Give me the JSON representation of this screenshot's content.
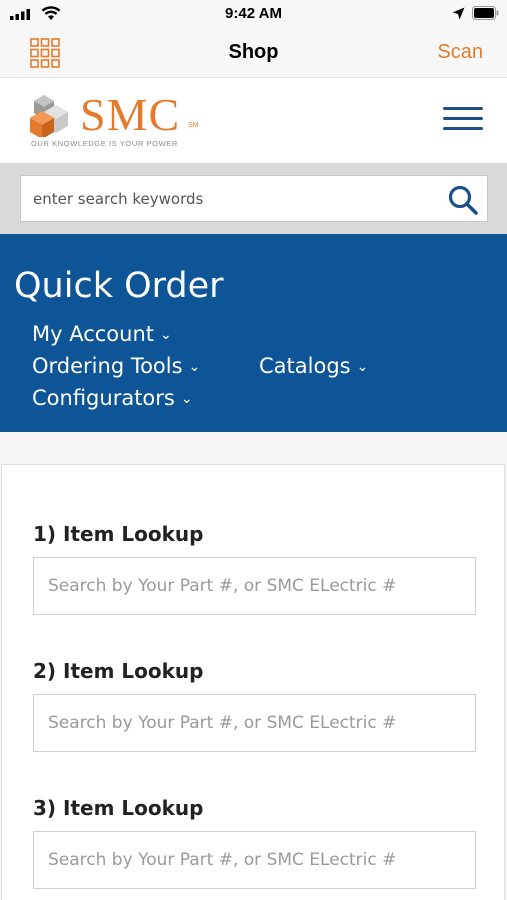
{
  "status_bar": {
    "time": "9:42 AM"
  },
  "nav_bar": {
    "title": "Shop",
    "scan_label": "Scan",
    "accent_color": "#e47b2c"
  },
  "header": {
    "logo_text": "SMC",
    "logo_sm": "SM",
    "logo_tagline": "OUR KNOWLEDGE IS YOUR POWER"
  },
  "search": {
    "placeholder": "enter search keywords"
  },
  "banner": {
    "title": "Quick Order",
    "background_color": "#0d5597",
    "menu": [
      {
        "label": "My Account"
      },
      {
        "label": "Ordering Tools"
      },
      {
        "label": "Catalogs"
      },
      {
        "label": "Configurators"
      }
    ]
  },
  "lookups": [
    {
      "label": "1) Item Lookup",
      "placeholder": "Search by Your Part #, or SMC ELectric #",
      "value": ""
    },
    {
      "label": "2) Item Lookup",
      "placeholder": "Search by Your Part #, or SMC ELectric #",
      "value": ""
    },
    {
      "label": "3) Item Lookup",
      "placeholder": "Search by Your Part #, or SMC ELectric #",
      "value": ""
    }
  ]
}
